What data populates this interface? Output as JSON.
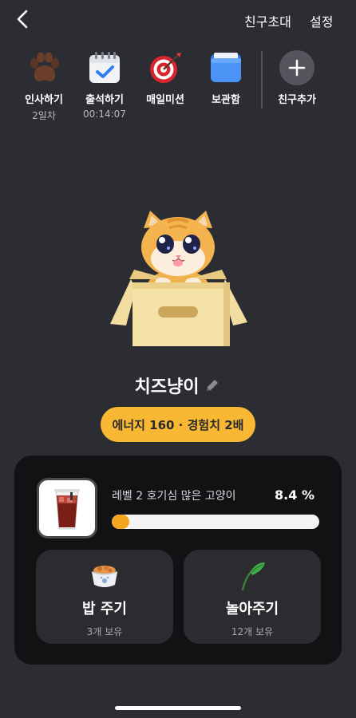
{
  "header": {
    "invite_label": "친구초대",
    "settings_label": "설정"
  },
  "quick_actions": [
    {
      "label": "인사하기",
      "sub": "2일차",
      "icon": "paw-icon"
    },
    {
      "label": "출석하기",
      "sub": "00:14:07",
      "icon": "calendar-check-icon"
    },
    {
      "label": "매일미션",
      "sub": "",
      "icon": "target-icon"
    },
    {
      "label": "보관함",
      "sub": "",
      "icon": "folder-icon"
    },
    {
      "label": "친구추가",
      "sub": "",
      "icon": "plus-icon"
    }
  ],
  "pet": {
    "name": "치즈냥이",
    "status_pill": "에너지 160 · 경험치 2배"
  },
  "level": {
    "text": "레벨 2 호기심 많은 고양이",
    "percent_label": "8.4 %",
    "progress": 0.084
  },
  "cards": [
    {
      "title": "밥 주기",
      "sub": "3개 보유",
      "icon": "food-bowl-icon"
    },
    {
      "title": "놀아주기",
      "sub": "12개 보유",
      "icon": "feather-toy-icon"
    }
  ]
}
